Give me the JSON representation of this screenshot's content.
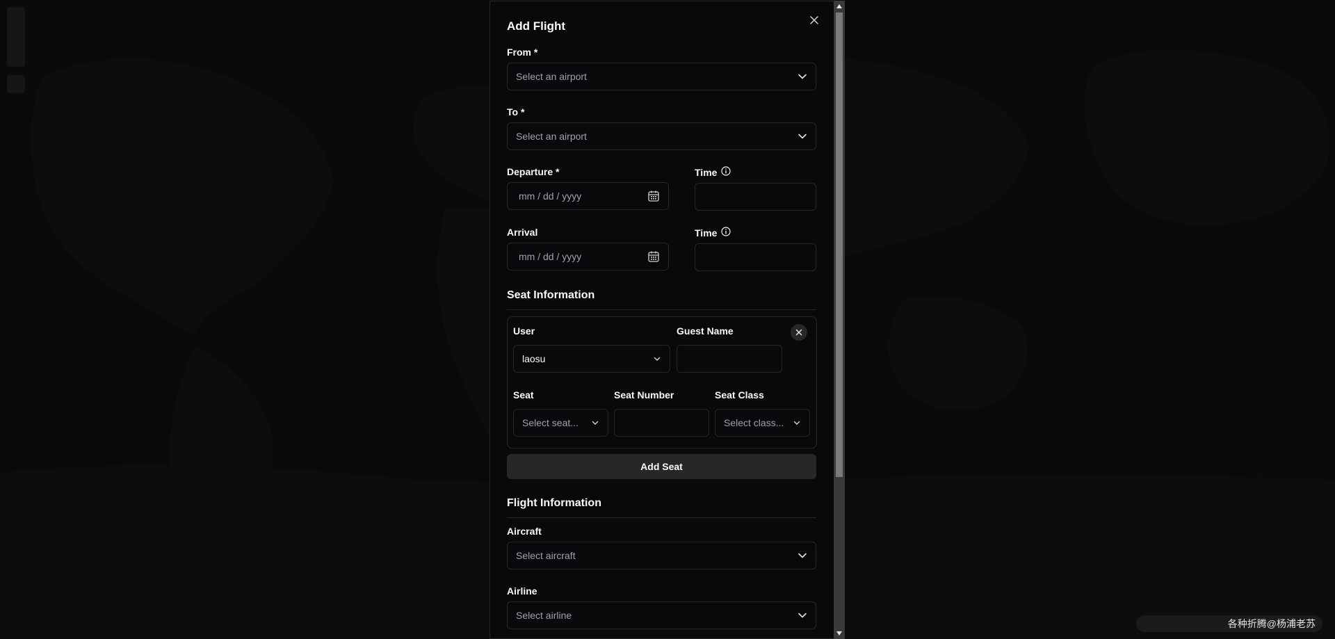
{
  "dialog": {
    "title": "Add Flight",
    "from": {
      "label": "From *",
      "placeholder": "Select an airport"
    },
    "to": {
      "label": "To *",
      "placeholder": "Select an airport"
    },
    "departure": {
      "label": "Departure *",
      "placeholder": "mm / dd / yyyy",
      "time_label": "Time"
    },
    "arrival": {
      "label": "Arrival",
      "placeholder": "mm / dd / yyyy",
      "time_label": "Time"
    },
    "seat_section": {
      "title": "Seat Information",
      "user_label": "User",
      "user_value": "laosu",
      "guest_label": "Guest Name",
      "seat_label": "Seat",
      "seat_placeholder": "Select seat...",
      "seat_number_label": "Seat Number",
      "seat_class_label": "Seat Class",
      "seat_class_placeholder": "Select class...",
      "add_seat": "Add Seat"
    },
    "flight_section": {
      "title": "Flight Information",
      "aircraft_label": "Aircraft",
      "aircraft_placeholder": "Select aircraft",
      "airline_label": "Airline",
      "airline_placeholder": "Select airline"
    }
  },
  "watermark": "各种折腾@杨浦老苏",
  "icons": {
    "close": "close-icon",
    "chevron": "chevron-down-icon",
    "calendar": "calendar-icon",
    "info": "info-icon"
  },
  "colors": {
    "background": "#0f1012",
    "dialog": "#09090b",
    "border": "#27272a",
    "muted_text": "#a1a1aa",
    "text": "#fafafa"
  }
}
